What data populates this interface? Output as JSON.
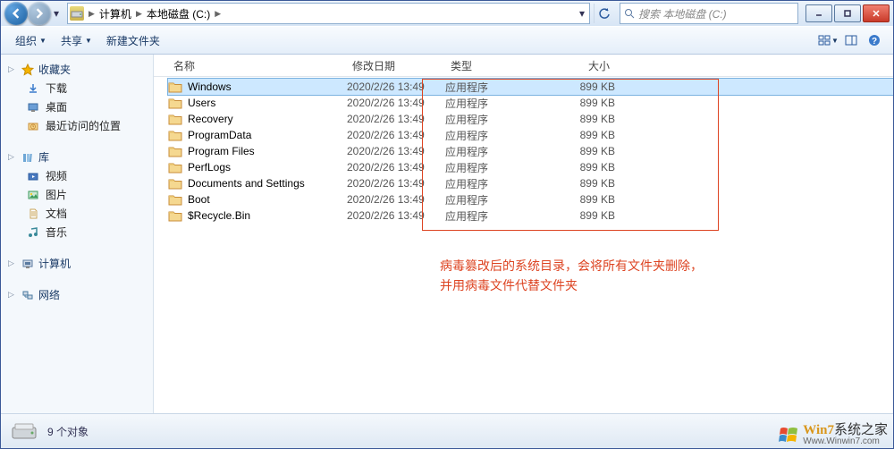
{
  "titlebar": {
    "breadcrumb": [
      "计算机",
      "本地磁盘 (C:)"
    ],
    "search_placeholder": "搜索 本地磁盘 (C:)"
  },
  "toolbar": {
    "organize": "组织",
    "share": "共享",
    "new_folder": "新建文件夹"
  },
  "sidebar": {
    "favorites": {
      "label": "收藏夹",
      "items": [
        "下载",
        "桌面",
        "最近访问的位置"
      ]
    },
    "libraries": {
      "label": "库",
      "items": [
        "视频",
        "图片",
        "文档",
        "音乐"
      ]
    },
    "computer": {
      "label": "计算机"
    },
    "network": {
      "label": "网络"
    }
  },
  "columns": {
    "name": "名称",
    "date": "修改日期",
    "type": "类型",
    "size": "大小"
  },
  "files": [
    {
      "name": "$Recycle.Bin",
      "date": "2020/2/26 13:49",
      "type": "应用程序",
      "size": "899 KB"
    },
    {
      "name": "Boot",
      "date": "2020/2/26 13:49",
      "type": "应用程序",
      "size": "899 KB"
    },
    {
      "name": "Documents and Settings",
      "date": "2020/2/26 13:49",
      "type": "应用程序",
      "size": "899 KB"
    },
    {
      "name": "PerfLogs",
      "date": "2020/2/26 13:49",
      "type": "应用程序",
      "size": "899 KB"
    },
    {
      "name": "Program Files",
      "date": "2020/2/26 13:49",
      "type": "应用程序",
      "size": "899 KB"
    },
    {
      "name": "ProgramData",
      "date": "2020/2/26 13:49",
      "type": "应用程序",
      "size": "899 KB"
    },
    {
      "name": "Recovery",
      "date": "2020/2/26 13:49",
      "type": "应用程序",
      "size": "899 KB"
    },
    {
      "name": "Users",
      "date": "2020/2/26 13:49",
      "type": "应用程序",
      "size": "899 KB"
    },
    {
      "name": "Windows",
      "date": "2020/2/26 13:49",
      "type": "应用程序",
      "size": "899 KB"
    }
  ],
  "selected_index": 8,
  "annotation": {
    "line1": "病毒篡改后的系统目录，会将所有文件夹删除，",
    "line2": "并用病毒文件代替文件夹"
  },
  "statusbar": {
    "count_text": "9 个对象"
  },
  "watermark": {
    "top_brand": "Win7",
    "top_rest": "系统之家",
    "sub": "Www.Winwin7.com"
  }
}
